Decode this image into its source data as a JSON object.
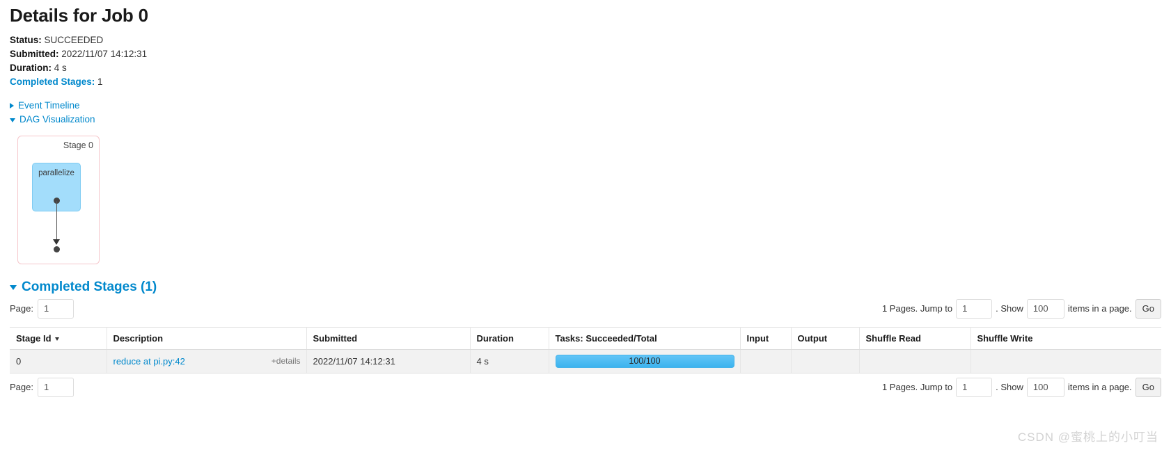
{
  "header": {
    "title": "Details for Job 0",
    "status_label": "Status:",
    "status_value": "SUCCEEDED",
    "submitted_label": "Submitted:",
    "submitted_value": "2022/11/07 14:12:31",
    "duration_label": "Duration:",
    "duration_value": "4 s",
    "completed_stages_label": "Completed Stages:",
    "completed_stages_value": "1"
  },
  "toggles": {
    "event_timeline": "Event Timeline",
    "dag_visualization": "DAG Visualization"
  },
  "dag": {
    "stage_label": "Stage 0",
    "node_label": "parallelize",
    "border_color": "#f5c6cb",
    "node_color": "#a3ddfb"
  },
  "completed_stages_section": {
    "heading": "Completed Stages (1)"
  },
  "pager": {
    "page_label": "Page:",
    "page_value": "1",
    "pages_text": "1 Pages. Jump to",
    "jump_value": "1",
    "show_label": ". Show",
    "show_value": "100",
    "items_text": "items in a page.",
    "go_label": "Go"
  },
  "table": {
    "columns": [
      {
        "label": "Stage Id",
        "sorted": true
      },
      {
        "label": "Description",
        "sorted": false
      },
      {
        "label": "Submitted",
        "sorted": false
      },
      {
        "label": "Duration",
        "sorted": false
      },
      {
        "label": "Tasks: Succeeded/Total",
        "sorted": false
      },
      {
        "label": "Input",
        "sorted": false
      },
      {
        "label": "Output",
        "sorted": false
      },
      {
        "label": "Shuffle Read",
        "sorted": false
      },
      {
        "label": "Shuffle Write",
        "sorted": false
      }
    ],
    "rows": [
      {
        "stage_id": "0",
        "description": "reduce at pi.py:42",
        "details_toggle": "+details",
        "submitted": "2022/11/07 14:12:31",
        "duration": "4 s",
        "tasks_text": "100/100",
        "tasks_percent": 100,
        "input": "",
        "output": "",
        "shuffle_read": "",
        "shuffle_write": ""
      }
    ]
  },
  "watermark": {
    "text": "CSDN @蜜桃上的小叮当"
  },
  "colors": {
    "link": "#0088cc",
    "progress": "#4fb9ee",
    "row_bg": "#f2f2f2"
  }
}
